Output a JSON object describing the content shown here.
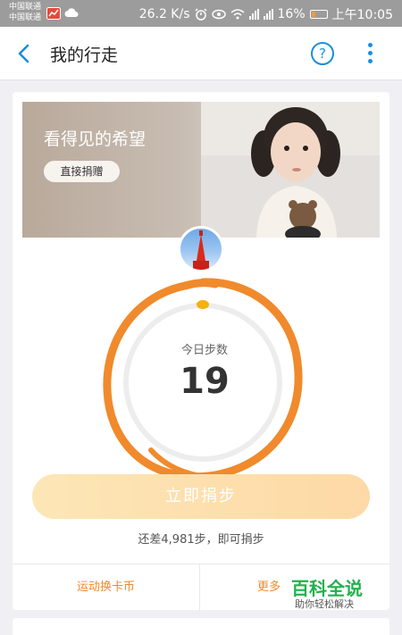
{
  "status_bar": {
    "carrier_1": "中国联通",
    "carrier_2": "中国联通",
    "speed": "26.2 K/s",
    "battery": "16%",
    "time": "上午10:05"
  },
  "header": {
    "title": "我的行走",
    "help_label": "?"
  },
  "banner": {
    "title": "看得见的希望",
    "button_label": "直接捐赠"
  },
  "steps": {
    "label": "今日步数",
    "value": "19",
    "accent_color": "#f5a623"
  },
  "actions": {
    "donate_steps_label": "立即捐步",
    "remaining_text": "还差4,981步，即可捐步"
  },
  "footer": {
    "left_label": "运动换卡币",
    "right_label": "更多"
  },
  "watermark": {
    "title": "百科全说",
    "subtitle": "助你轻松解决"
  }
}
